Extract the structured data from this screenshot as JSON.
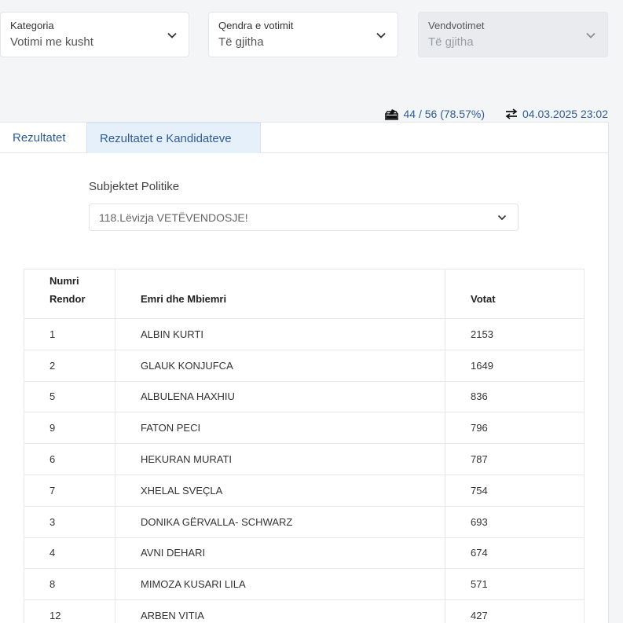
{
  "filters": {
    "category": {
      "label": "Kategoria",
      "value": "Votimi me kusht"
    },
    "center": {
      "label": "Qendra e votimit",
      "value": "Të gjitha"
    },
    "stations": {
      "label": "Vendvotimet",
      "value": "Të gjitha"
    }
  },
  "status": {
    "counted": "44 / 56 (78.57%)",
    "updated": "04.03.2025 23:02"
  },
  "tabs": [
    {
      "label": "Rezultatet"
    },
    {
      "label": "Rezultatet e Kandidateve"
    }
  ],
  "subject": {
    "label": "Subjektet Politike",
    "value": "118.Lëvizja VETËVENDOSJE!"
  },
  "table": {
    "headers": {
      "num_line1": "Numri",
      "num_line2": "Rendor",
      "name": "Emri dhe Mbiemri",
      "votes": "Votat"
    },
    "rows": [
      {
        "num": "1",
        "name": "ALBIN KURTI",
        "votes": "2153"
      },
      {
        "num": "2",
        "name": "GLAUK KONJUFCA",
        "votes": "1649"
      },
      {
        "num": "5",
        "name": "ALBULENA HAXHIU",
        "votes": "836"
      },
      {
        "num": "9",
        "name": "FATON PECI",
        "votes": "796"
      },
      {
        "num": "6",
        "name": "HEKURAN MURATI",
        "votes": "787"
      },
      {
        "num": "7",
        "name": "XHELAL SVEÇLA",
        "votes": "754"
      },
      {
        "num": "3",
        "name": "DONIKA GËRVALLA- SCHWARZ",
        "votes": "693"
      },
      {
        "num": "4",
        "name": "AVNI DEHARI",
        "votes": "674"
      },
      {
        "num": "8",
        "name": "MIMOZA KUSARI LILA",
        "votes": "571"
      },
      {
        "num": "12",
        "name": "ARBEN VITIA",
        "votes": "427"
      }
    ]
  }
}
